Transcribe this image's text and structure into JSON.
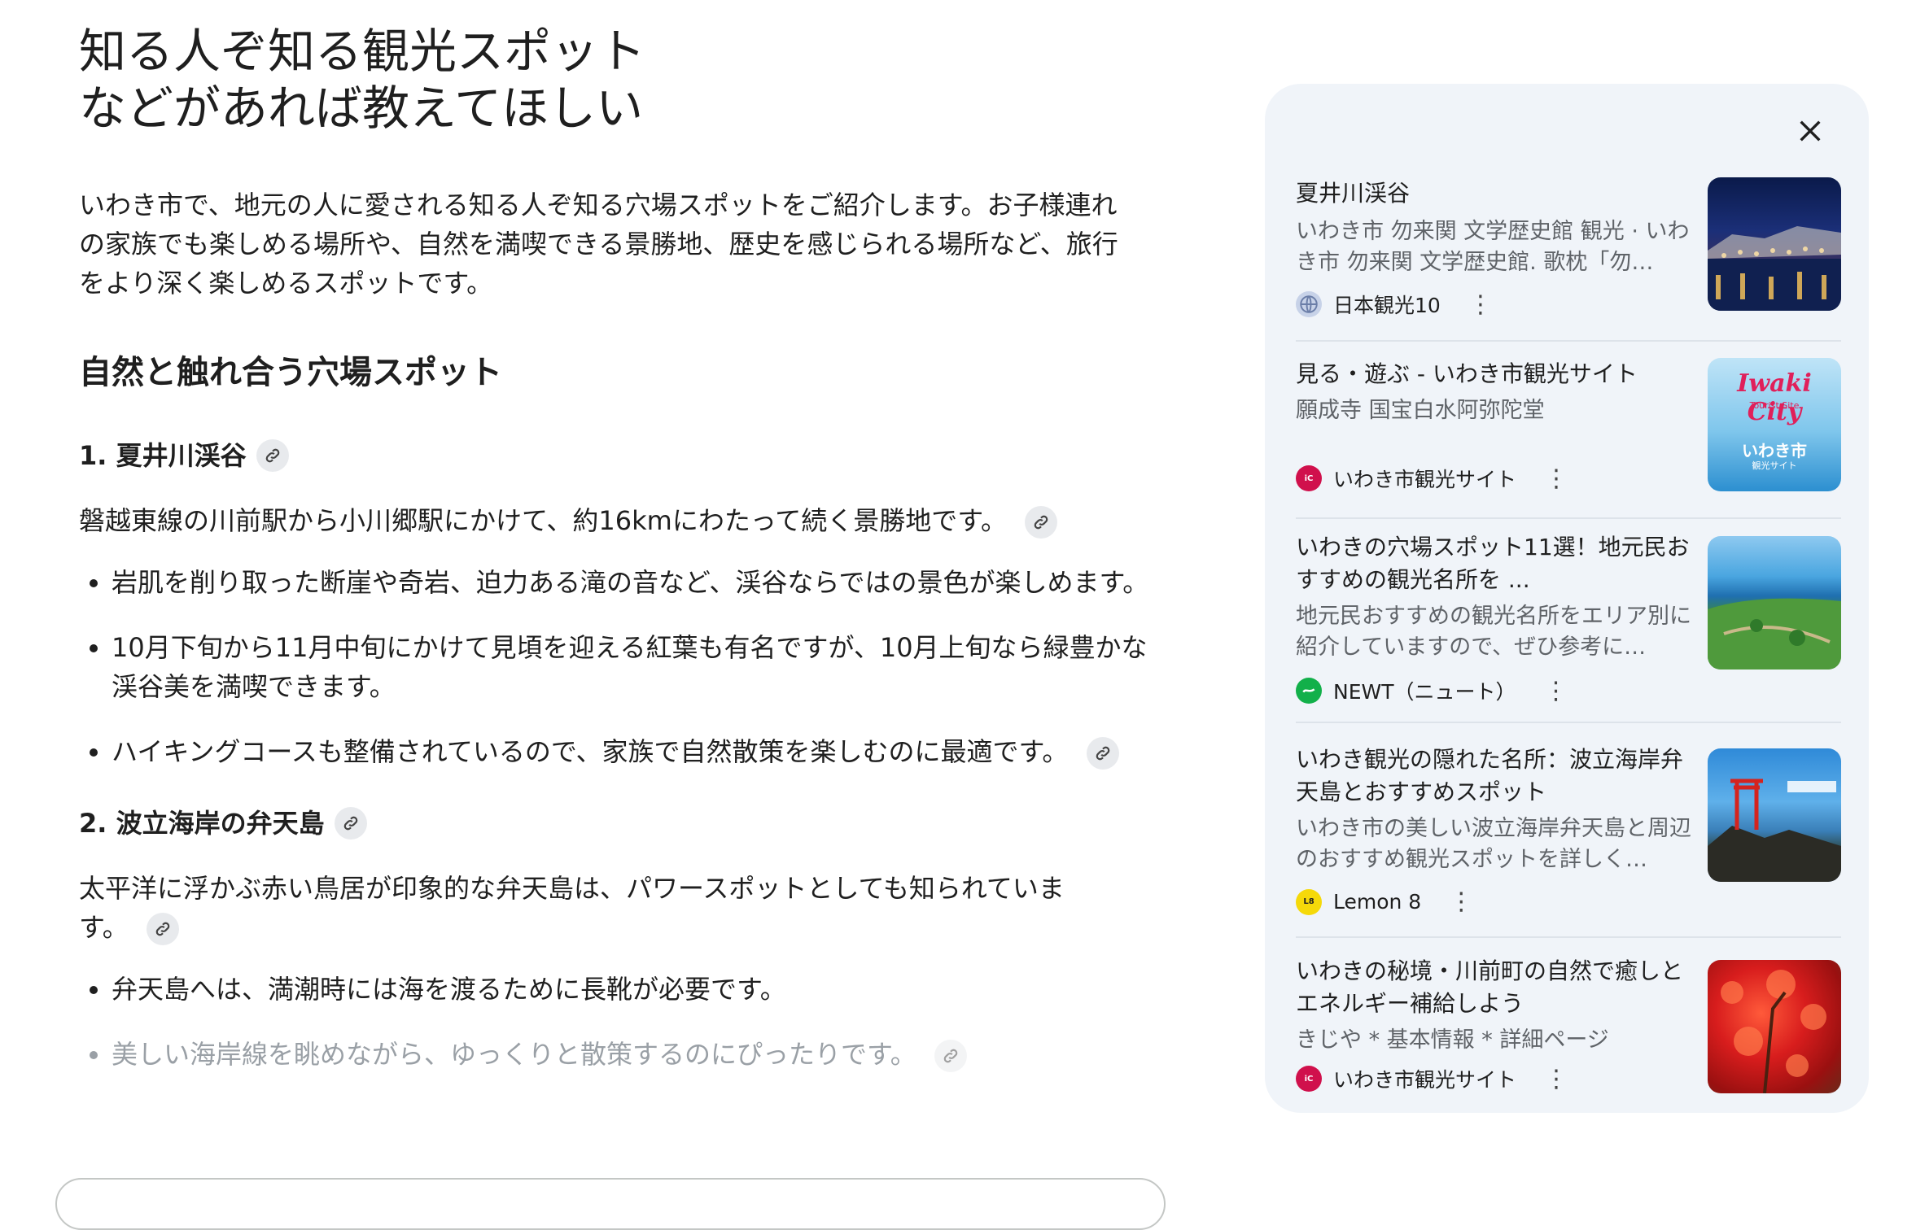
{
  "question": "知る人ぞ知る観光スポット\nなどがあれば教えてほしい",
  "answer": {
    "intro": "いわき市で、地元の人に愛される知る人ぞ知る穴場スポットをご紹介します。お子様連れの家族でも楽しめる場所や、自然を満喫できる景勝地、歴史を感じられる場所など、旅行をより深く楽しめるスポットです。",
    "section_heading": "自然と触れ合う穴場スポット",
    "spot1": {
      "heading": "1. 夏井川渓谷",
      "desc": "磐越東線の川前駅から小川郷駅にかけて、約16kmにわたって続く景勝地です。",
      "bullets": [
        "岩肌を削り取った断崖や奇岩、迫力ある滝の音など、渓谷ならではの景色が楽しめます。",
        "10月下旬から11月中旬にかけて見頃を迎える紅葉も有名ですが、10月上旬なら緑豊かな渓谷美を満喫できます。",
        "ハイキングコースも整備されているので、家族で自然散策を楽しむのに最適です。"
      ]
    },
    "spot2": {
      "heading": "2. 波立海岸の弁天島",
      "desc": "太平洋に浮かぶ赤い鳥居が印象的な弁天島は、パワースポットとしても知られています。",
      "bullets": [
        "弁天島へは、満潮時には海を渡るために長靴が必要です。",
        "美しい海岸線を眺めながら、ゆっくりと散策するのにぴったりです。"
      ]
    }
  },
  "sources": [
    {
      "title": "夏井川渓谷",
      "snippet": "いわき市 勿来関 文学歴史館 観光 · いわき市 勿来関 文学歴史館. 歌枕「勿…",
      "site": "日本観光10",
      "favicon": "globe-icon",
      "thumb": "night-riverside-lanterns"
    },
    {
      "title": "見る・遊ぶ - いわき市観光サイト",
      "snippet": "願成寺 国宝白水阿弥陀堂",
      "site": "いわき市観光サイト",
      "favicon": "iwaki-city-icon",
      "thumb": "iwaki-city-logo",
      "thumb_text": "Iwaki City",
      "thumb_sub": "Tourist Site",
      "thumb_jp": "いわき市",
      "thumb_jp_sub": "観光サイト"
    },
    {
      "title": "いわきの穴場スポット11選！地元民おすすめの観光名所を ...",
      "snippet": "地元民おすすめの観光名所をエリア別に紹介していますので、ぜひ参考に…",
      "site": "NEWT（ニュート）",
      "favicon": "newt-icon",
      "thumb": "coastal-park-aerial"
    },
    {
      "title": "いわき観光の隠れた名所：波立海岸弁天島とおすすめスポット",
      "snippet": "いわき市の美しい波立海岸弁天島と周辺のおすすめ観光スポットを詳しく…",
      "site": "Lemon 8",
      "favicon": "lemon8-icon",
      "thumb": "torii-on-rocks"
    },
    {
      "title": "いわきの秘境・川前町の自然で癒しとエネルギー補給しよう",
      "snippet": "きじや * 基本情報 * 詳細ページ",
      "site": "いわき市観光サイト",
      "favicon": "iwaki-city-icon",
      "thumb": "red-autumn-leaves"
    }
  ],
  "colors": {
    "panel_bg": "#f0f4f9",
    "text": "#1f1f1f",
    "muted": "#5f6368",
    "chip_bg": "#e8eaed"
  }
}
